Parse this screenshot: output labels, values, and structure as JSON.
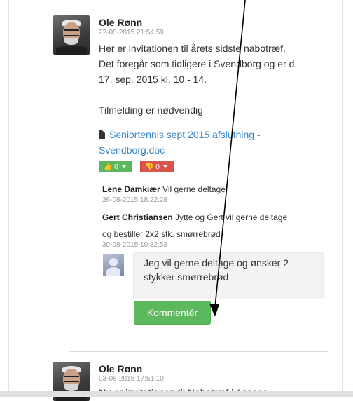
{
  "post1": {
    "author": "Ole Rønn",
    "timestamp": "22-08-2015 21:54:59",
    "body_lines": [
      "Her er invitationen til årets sidste nabotræf.",
      "Det foregår som tidligere i Svendborg og er d.",
      "17. sep. 2015 kl. 10 - 14.",
      "",
      "Tilmelding er nødvendig"
    ],
    "attachment": {
      "icon": "document-icon",
      "line1": "Seniortennis sept 2015 afslutning -",
      "line2": "Svendborg.doc"
    },
    "votes": {
      "up_count": "0",
      "down_count": "0",
      "up_color": "#5cb85c",
      "down_color": "#d9534f"
    }
  },
  "comments": [
    {
      "author": "Lene Damkiær",
      "text": "Vil gerne deltage",
      "timestamp": "26-08-2015 18:22:28"
    },
    {
      "author": "Gert Christiansen",
      "text_line1": "Jytte og Gert vil gerne deltage",
      "text_line2": "og bestiller 2x2 stk. smørrebrød",
      "timestamp": "30-08-2015 10:32:53"
    }
  ],
  "reply": {
    "value": "Jeg vil gerne deltage og ønsker 2 stykker smørrebrød",
    "submit_label": "Kommentér"
  },
  "post2": {
    "author": "Ole Rønn",
    "timestamp": "03-08-2015 17:51:10",
    "body_preview": "Nu er invitationen til Nabotræf i Assens"
  }
}
